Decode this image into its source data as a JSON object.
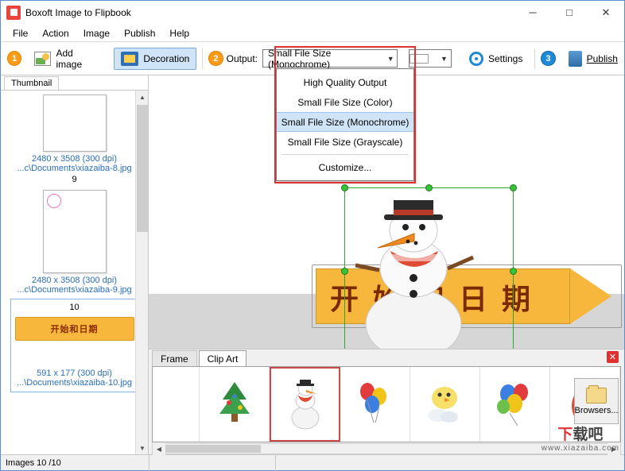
{
  "window": {
    "title": "Boxoft Image to Flipbook",
    "icon": "app-icon",
    "minimize": "─",
    "maximize": "□",
    "close": "✕"
  },
  "menubar": [
    {
      "label": "File"
    },
    {
      "label": "Action"
    },
    {
      "label": "Image"
    },
    {
      "label": "Publish"
    },
    {
      "label": "Help"
    }
  ],
  "toolbar": {
    "step1": "1",
    "add_image": "Add image",
    "decoration": "Decoration",
    "step2": "2",
    "output_label": "Output:",
    "output_value": "Small File Size (Monochrome)",
    "settings": "Settings",
    "step3": "3",
    "publish": "Publish"
  },
  "output_dropdown": {
    "items": [
      {
        "label": "High Quality Output",
        "selected": false
      },
      {
        "label": "Small File Size (Color)",
        "selected": false
      },
      {
        "label": "Small File Size (Monochrome)",
        "selected": true
      },
      {
        "label": "Small File Size (Grayscale)",
        "selected": false
      },
      {
        "label": "Customize...",
        "selected": false
      }
    ]
  },
  "thumbnail_panel": {
    "tab": "Thumbnail",
    "items": [
      {
        "page": "9",
        "dimensions": "2480 x 3508 (300 dpi)",
        "path": "...c\\Documents\\xiazaiba-8.jpg",
        "selected": false
      },
      {
        "page": "10",
        "dimensions": "2480 x 3508 (300 dpi)",
        "path": "...c\\Documents\\xiazaiba-9.jpg",
        "selected": false
      },
      {
        "page": "10",
        "dimensions": "591 x 177 (300 dpi)",
        "path": "...\\Documents\\xiazaiba-10.jpg",
        "selected": true,
        "banner_text": "开始和日期"
      }
    ]
  },
  "canvas": {
    "banner_text": "开始和日期"
  },
  "bottom_panel": {
    "tabs": [
      {
        "label": "Frame",
        "active": false
      },
      {
        "label": "Clip Art",
        "active": true
      }
    ],
    "close_label": "✕",
    "clipart": [
      {
        "name": "christmas-tree-clip",
        "selected": false
      },
      {
        "name": "snowman-clip",
        "selected": true
      },
      {
        "name": "balloons-merry-clip",
        "selected": false
      },
      {
        "name": "chick-cloud-clip",
        "selected": false
      },
      {
        "name": "balloons-party-clip",
        "selected": false
      },
      {
        "name": "santa-clip",
        "selected": false
      }
    ],
    "browse_button": "Browsers..."
  },
  "statusbar": {
    "images": "Images 10 /10"
  },
  "watermark": {
    "main_left": "下",
    "main_right": "载吧",
    "sub": "www.xiazaiba.com"
  },
  "colors": {
    "accent_orange": "#ff9a17",
    "accent_blue": "#1e8ad6",
    "highlight_red": "#e03030",
    "selection_green": "#2fa82f",
    "banner_yellow": "#f6b73c",
    "link_blue": "#2a6ebb"
  }
}
